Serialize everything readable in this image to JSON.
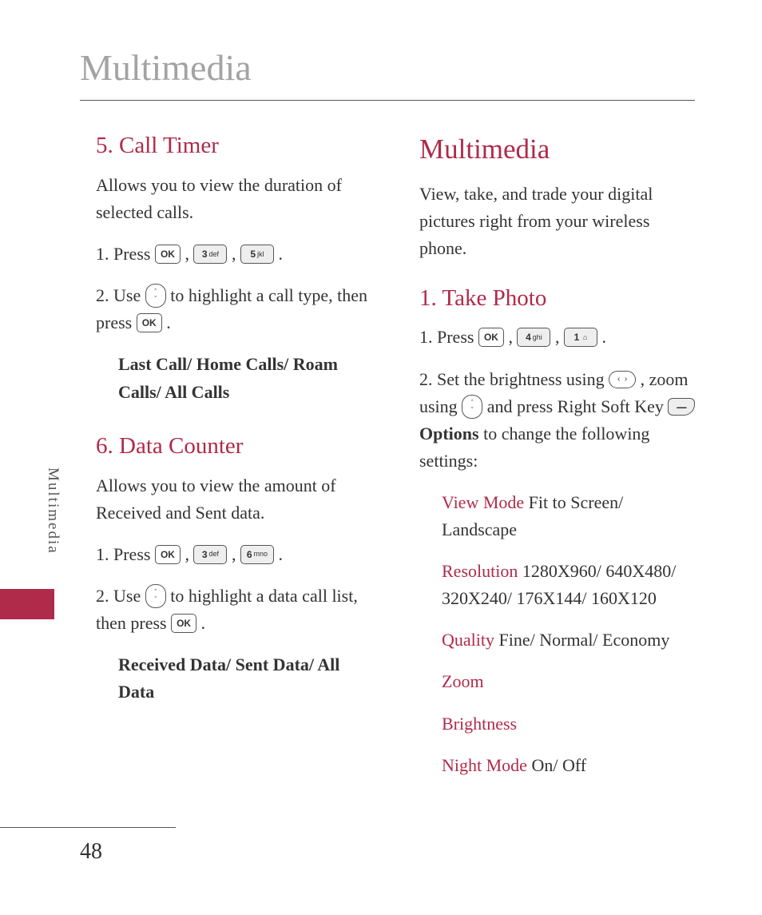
{
  "pageTitle": "Multimedia",
  "sideTab": "Multimedia",
  "pageNumber": "48",
  "keys": {
    "ok": "OK",
    "k3": "3",
    "k3s": "def",
    "k5": "5",
    "k5s": "jkl",
    "k6": "6",
    "k6s": "mno",
    "k4": "4",
    "k4s": "ghi",
    "k1": "1"
  },
  "left": {
    "s1": {
      "heading": "5. Call Timer",
      "intro": "Allows you to view the duration of selected calls.",
      "step1a": "1. Press  ",
      "sep": " ,   ",
      "end": " .",
      "step2a": "2. Use  ",
      "step2b": " to highlight a call type, then press ",
      "step2c": " .",
      "options": "Last Call/ Home Calls/ Roam Calls/ All Calls"
    },
    "s2": {
      "heading": "6. Data Counter",
      "intro": "Allows you to view the amount of Received and Sent data.",
      "step1a": "1. Press  ",
      "sep": " ,   ",
      "end": " .",
      "step2a": "2. Use  ",
      "step2b": "  to highlight a data call list, then press ",
      "step2c": " .",
      "options": "Received Data/ Sent Data/ All Data"
    }
  },
  "right": {
    "heading": "Multimedia",
    "intro": "View, take, and trade your digital pictures right from your wireless phone.",
    "s1": {
      "heading": "1. Take Photo",
      "step1a": "1. Press  ",
      "sep": " ,   ",
      "end": " .",
      "step2a": "2. Set the brightness using  ",
      "step2b": " , zoom using  ",
      "step2c": "  and press Right Soft Key  ",
      "step2d": "  ",
      "optionsWord": "Options",
      "step2e": " to change the following settings:",
      "opts": {
        "l1a": "View Mode",
        "l1b": "  Fit to Screen/ Landscape",
        "l2a": "Resolution",
        "l2b": " 1280X960/ 640X480/ 320X240/ 176X144/ 160X120",
        "l3a": "Quality",
        "l3b": " Fine/ Normal/ Economy",
        "l4": "Zoom",
        "l5": "Brightness",
        "l6a": "Night Mode",
        "l6b": "  On/ Off"
      }
    }
  }
}
